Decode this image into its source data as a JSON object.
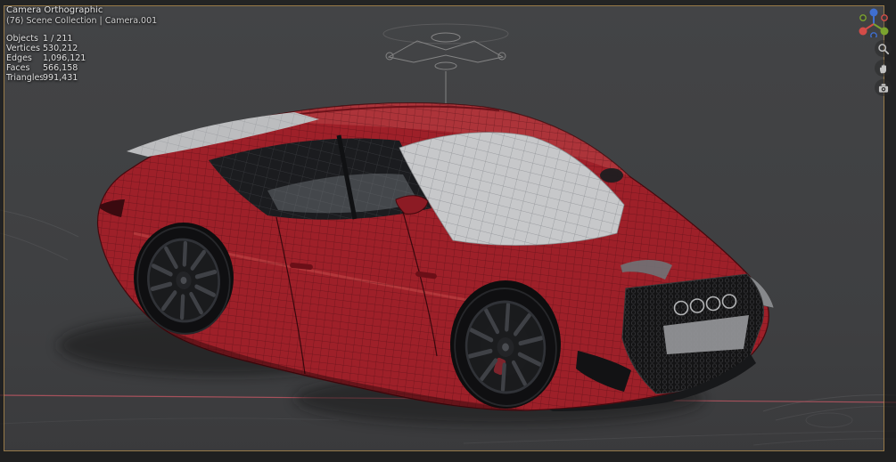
{
  "header": {
    "view_label": "Camera Orthographic",
    "context": "(76) Scene Collection | Camera.001"
  },
  "stats": {
    "rows": [
      {
        "label": "Objects",
        "value": "1 / 211"
      },
      {
        "label": "Vertices",
        "value": "530,212"
      },
      {
        "label": "Edges",
        "value": "1,096,121"
      },
      {
        "label": "Faces",
        "value": "566,158"
      },
      {
        "label": "Triangles",
        "value": "991,431"
      }
    ]
  },
  "nav": {
    "buttons": [
      {
        "icon": "orientation-gizmo"
      },
      {
        "icon": "magnifier"
      },
      {
        "icon": "hand"
      },
      {
        "icon": "camera"
      }
    ]
  },
  "colors": {
    "viewport_background": "#3e3f41",
    "passepartout_dim": "rgba(16,16,16,0.62)",
    "camera_border": "#a8854a",
    "car_paint": "#9e2029",
    "wireframe": "#3a070d",
    "glass": "#c7c8ca",
    "axis_x_line": "#c15663",
    "gizmo_x": "#d34c48",
    "gizmo_y": "#7ba32e",
    "gizmo_z": "#3f6fd0"
  }
}
